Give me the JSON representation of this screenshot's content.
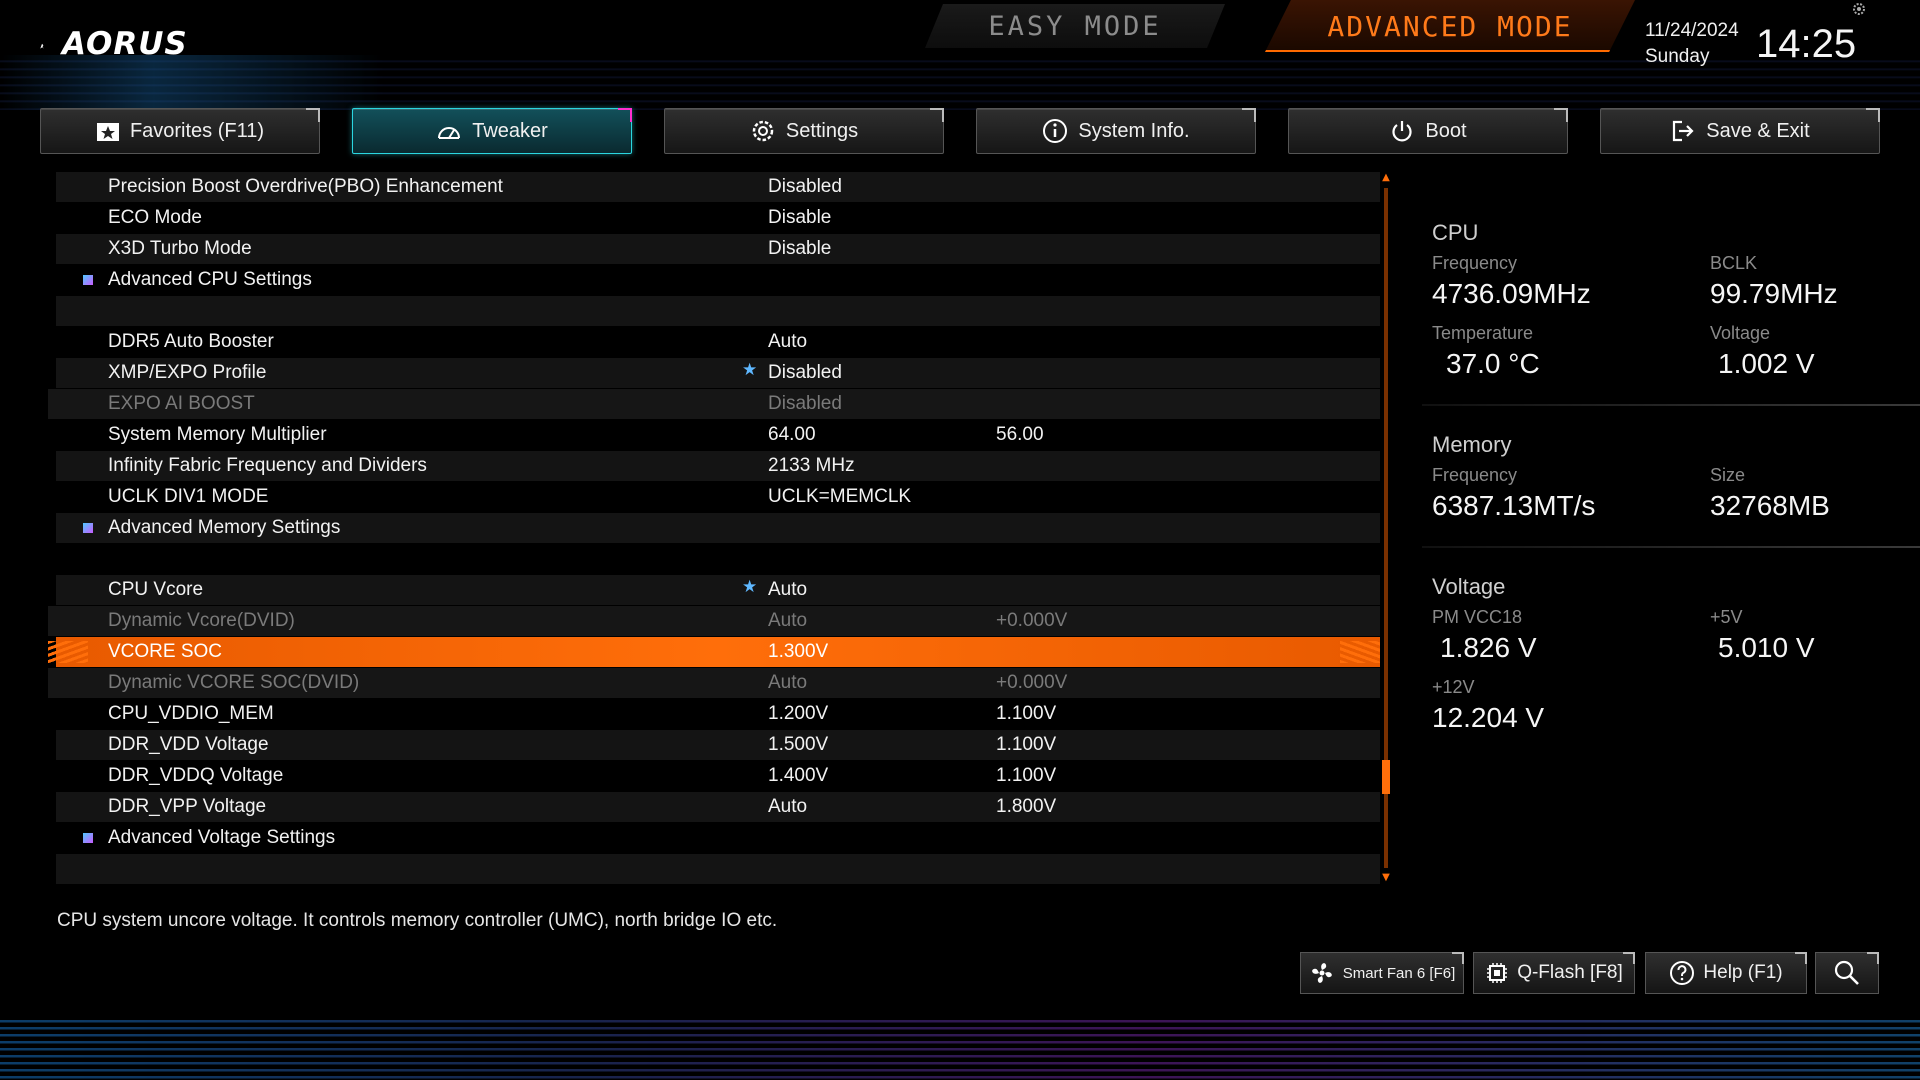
{
  "brand": {
    "logo_text": "AORUS"
  },
  "modes": {
    "easy": "EASY MODE",
    "advanced": "ADVANCED MODE"
  },
  "clock": {
    "date": "11/24/2024",
    "day": "Sunday",
    "time": "14:25"
  },
  "tabs": [
    {
      "label": "Favorites (F11)",
      "icon": "star-icon"
    },
    {
      "label": "Tweaker",
      "icon": "gauge-icon"
    },
    {
      "label": "Settings",
      "icon": "gear-icon"
    },
    {
      "label": "System Info.",
      "icon": "info-icon"
    },
    {
      "label": "Boot",
      "icon": "power-icon"
    },
    {
      "label": "Save & Exit",
      "icon": "exit-icon"
    }
  ],
  "settings": [
    {
      "label": "Precision Boost Overdrive(PBO) Enhancement",
      "value": "Disabled",
      "value2": ""
    },
    {
      "label": "ECO Mode",
      "value": "Disable",
      "value2": ""
    },
    {
      "label": "X3D Turbo Mode",
      "value": "Disable",
      "value2": ""
    },
    {
      "label": "Advanced CPU Settings",
      "value": "",
      "value2": ""
    },
    {
      "label": "",
      "value": "",
      "value2": ""
    },
    {
      "label": "DDR5 Auto Booster",
      "value": "Auto",
      "value2": ""
    },
    {
      "label": "XMP/EXPO Profile",
      "value": "Disabled",
      "value2": ""
    },
    {
      "label": "EXPO AI BOOST",
      "value": "Disabled",
      "value2": ""
    },
    {
      "label": "System Memory Multiplier",
      "value": "64.00",
      "value2": "56.00"
    },
    {
      "label": "Infinity Fabric Frequency and Dividers",
      "value": "2133 MHz",
      "value2": ""
    },
    {
      "label": "UCLK DIV1 MODE",
      "value": "UCLK=MEMCLK",
      "value2": ""
    },
    {
      "label": "Advanced Memory Settings",
      "value": "",
      "value2": ""
    },
    {
      "label": "",
      "value": "",
      "value2": ""
    },
    {
      "label": "CPU Vcore",
      "value": "Auto",
      "value2": ""
    },
    {
      "label": "Dynamic Vcore(DVID)",
      "value": "Auto",
      "value2": "+0.000V"
    },
    {
      "label": "VCORE SOC",
      "value": "1.300V",
      "value2": ""
    },
    {
      "label": "Dynamic VCORE SOC(DVID)",
      "value": "Auto",
      "value2": "+0.000V"
    },
    {
      "label": "CPU_VDDIO_MEM",
      "value": "1.200V",
      "value2": "1.100V"
    },
    {
      "label": "DDR_VDD Voltage",
      "value": "1.500V",
      "value2": "1.100V"
    },
    {
      "label": "DDR_VDDQ Voltage",
      "value": "1.400V",
      "value2": "1.100V"
    },
    {
      "label": "DDR_VPP Voltage",
      "value": "Auto",
      "value2": "1.800V"
    },
    {
      "label": "Advanced Voltage Settings",
      "value": "",
      "value2": ""
    },
    {
      "label": "",
      "value": "",
      "value2": ""
    }
  ],
  "info": {
    "cpu": {
      "title": "CPU",
      "freq_label": "Frequency",
      "freq": "4736.09MHz",
      "bclk_label": "BCLK",
      "bclk": "99.79MHz",
      "temp_label": "Temperature",
      "temp": "37.0 °C",
      "volt_label": "Voltage",
      "volt": "1.002 V"
    },
    "memory": {
      "title": "Memory",
      "freq_label": "Frequency",
      "freq": "6387.13MT/s",
      "size_label": "Size",
      "size": "32768MB"
    },
    "voltage": {
      "title": "Voltage",
      "pm_label": "PM VCC18",
      "pm": "1.826 V",
      "p5_label": "+5V",
      "p5": "5.010 V",
      "p12_label": "+12V",
      "p12": "12.204 V"
    }
  },
  "description": "CPU system uncore voltage. It controls memory controller (UMC), north bridge IO etc.",
  "bottom_buttons": {
    "smart_fan": "Smart Fan 6 [F6]",
    "qflash": "Q-Flash [F8]",
    "help": "Help (F1)"
  },
  "colors": {
    "accent": "#ff6e0a",
    "tab_active": "#2bd6e0",
    "star": "#5fb8ff"
  }
}
